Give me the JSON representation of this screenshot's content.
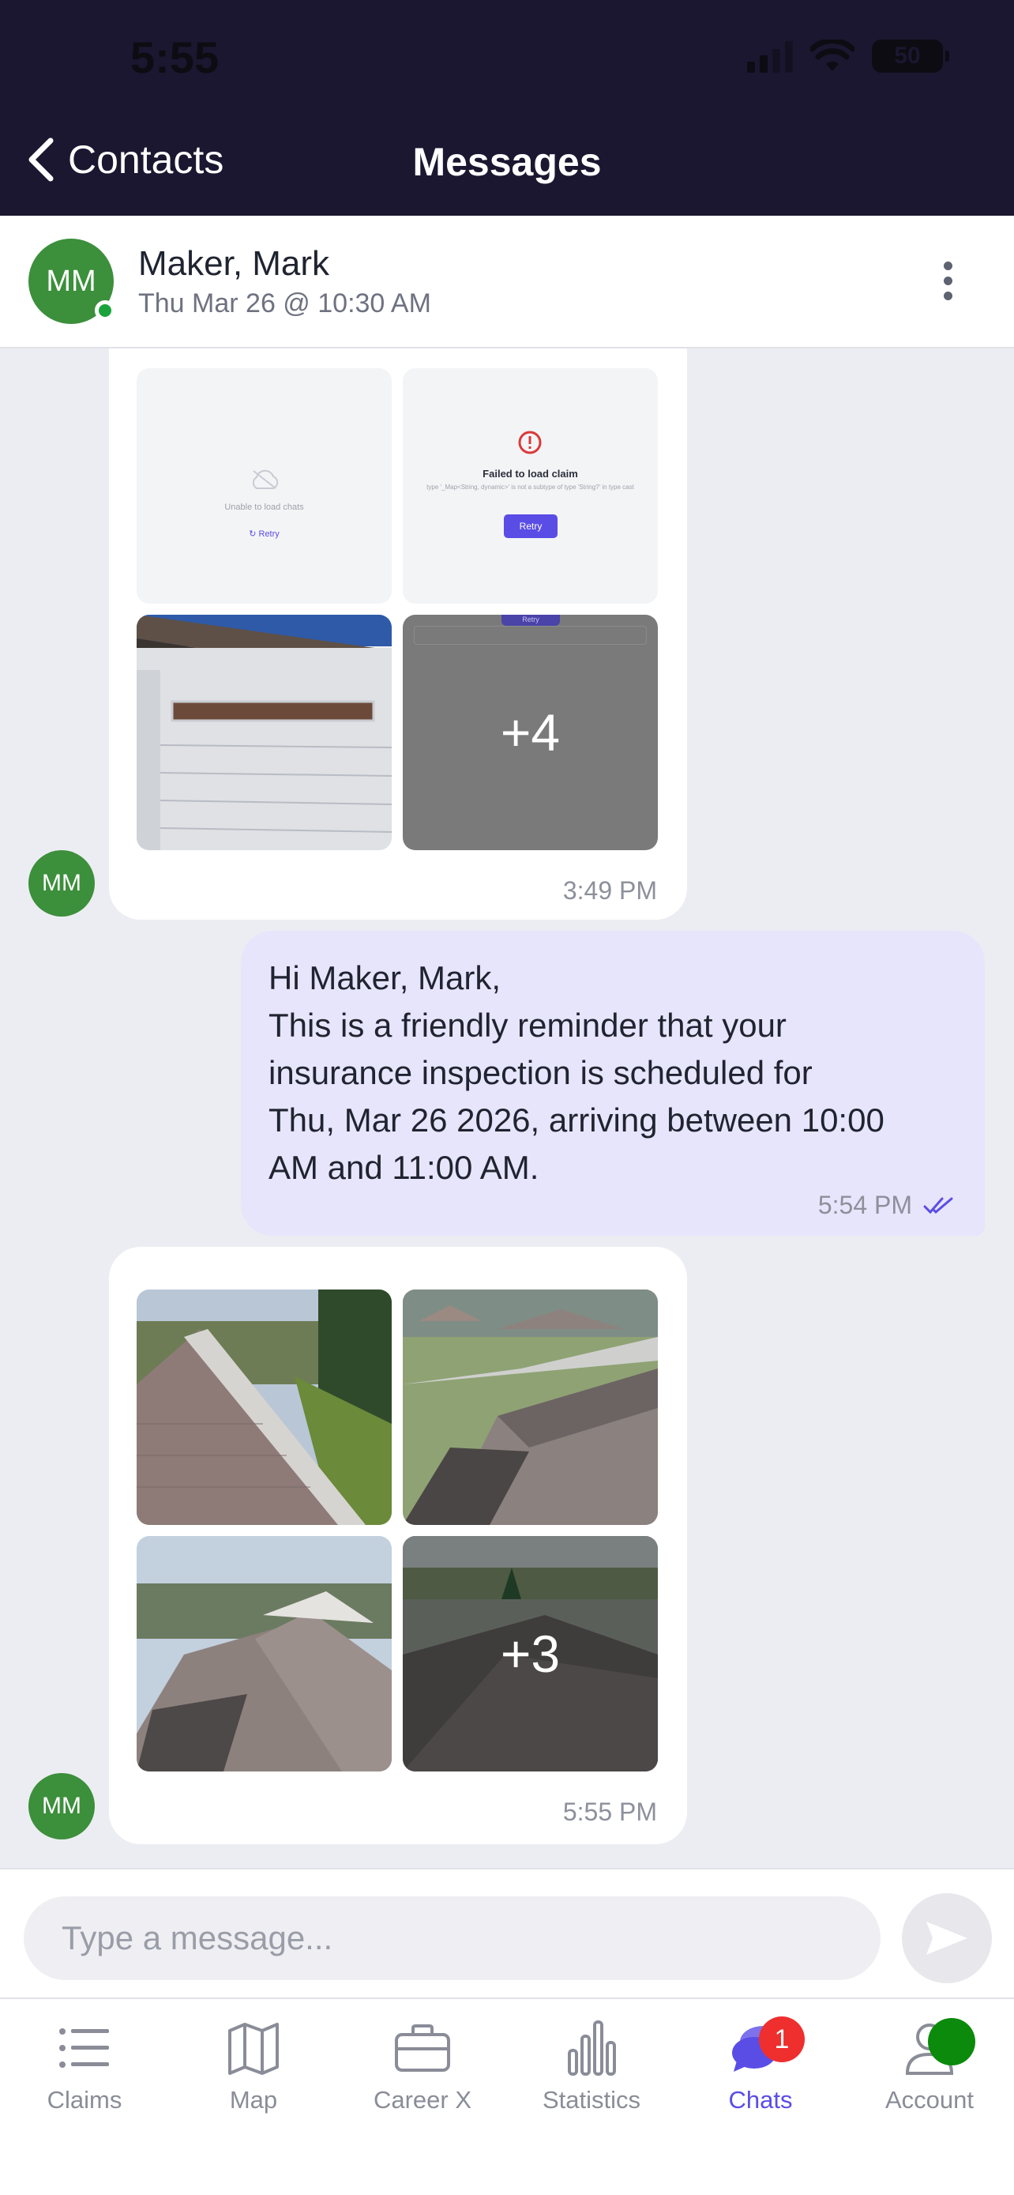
{
  "status": {
    "time": "5:55",
    "battery": "50"
  },
  "nav": {
    "back_label": "Contacts",
    "title": "Messages"
  },
  "contact": {
    "initials": "MM",
    "name": "Maker, Mark",
    "appointment": "Thu Mar 26 @ 10:30 AM"
  },
  "messages": [
    {
      "type": "incoming-images",
      "avatar": "MM",
      "time": "3:49 PM",
      "tiles": [
        {
          "kind": "screenshot",
          "text": "Unable to load chats",
          "action": "Retry"
        },
        {
          "kind": "screenshot",
          "title": "Failed to load claim",
          "detail": "type '_Map<String, dynamic>' is not a subtype of type 'String?' in type cast",
          "action": "Retry"
        },
        {
          "kind": "photo"
        },
        {
          "kind": "more",
          "overlay": "+4",
          "peek_label": "Retry"
        }
      ]
    },
    {
      "type": "outgoing-text",
      "lines": [
        "Hi Maker, Mark,",
        "This is a friendly reminder that your",
        "insurance inspection is scheduled for",
        "Thu, Mar 26 2026, arriving between 10:00",
        "AM and 11:00 AM."
      ],
      "time": "5:54 PM",
      "status": "read"
    },
    {
      "type": "incoming-images",
      "avatar": "MM",
      "time": "5:55 PM",
      "tiles": [
        {
          "kind": "photo"
        },
        {
          "kind": "photo"
        },
        {
          "kind": "photo"
        },
        {
          "kind": "more",
          "overlay": "+3"
        }
      ]
    }
  ],
  "composer": {
    "placeholder": "Type a message..."
  },
  "tabs": [
    {
      "label": "Claims",
      "icon": "list-icon"
    },
    {
      "label": "Map",
      "icon": "map-icon"
    },
    {
      "label": "Career X",
      "icon": "briefcase-icon"
    },
    {
      "label": "Statistics",
      "icon": "bar-chart-icon"
    },
    {
      "label": "Chats",
      "icon": "chat-icon",
      "badge": "1",
      "active": true
    },
    {
      "label": "Account",
      "icon": "person-icon"
    }
  ],
  "colors": {
    "header": "#1b1730",
    "accent": "#5a4de6",
    "avatar": "#3c8f3b",
    "outgoing_bubble": "#e7e5fb",
    "badge": "#ef2e2e"
  }
}
